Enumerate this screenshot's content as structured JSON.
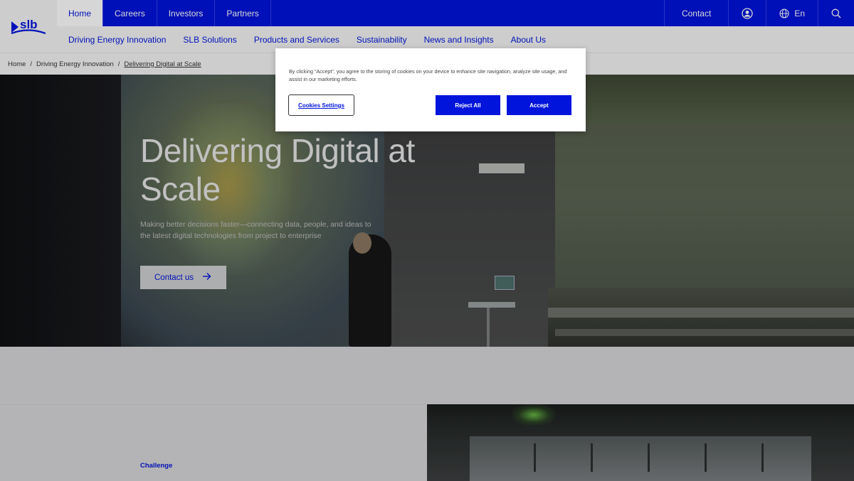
{
  "nav": {
    "logo_text": "slb",
    "primary": [
      "Home",
      "Careers",
      "Investors",
      "Partners"
    ],
    "active_primary": "Home",
    "utility": {
      "contact_label": "Contact",
      "account_icon": "user-circle-icon",
      "language_icon": "globe-icon",
      "language_label": "En",
      "search_icon": "search-icon"
    },
    "secondary": [
      "Driving Energy Innovation",
      "SLB Solutions",
      "Products and Services",
      "Sustainability",
      "News and Insights",
      "About Us"
    ]
  },
  "breadcrumb": [
    "Home",
    "Driving Energy Innovation",
    "Delivering Digital at Scale"
  ],
  "hero": {
    "title": "Delivering Digital at Scale",
    "subtitle": "Making better decisions faster—connecting data, people, and ideas to the latest digital technologies from project to enterprise",
    "cta_label": "Contact us"
  },
  "section": {
    "label": "Challenge"
  },
  "cookie_banner": {
    "text": "By clicking “Accept”, you agree to the storing of cookies on your device to enhance site navigation, analyze site usage, and assist in our marketing efforts.",
    "settings_label": "Cookies Settings",
    "reject_label": "Reject All",
    "accept_label": "Accept"
  },
  "colors": {
    "brand_blue": "#0014dc",
    "nav_bg": "#0014dc",
    "light_bg": "#f5f5f6"
  }
}
